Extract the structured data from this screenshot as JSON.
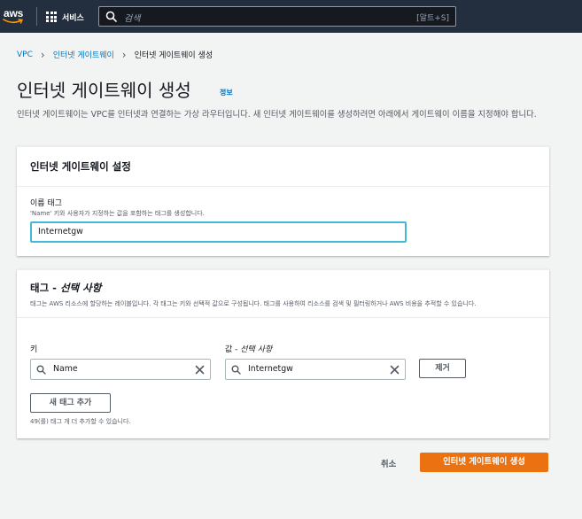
{
  "nav": {
    "logo_text": "aws",
    "services_label": "서비스",
    "search_placeholder": "검색",
    "search_shortcut": "[알트+S]"
  },
  "breadcrumb": {
    "items": [
      "VPC",
      "인터넷 게이트웨이",
      "인터넷 게이트웨이 생성"
    ]
  },
  "page": {
    "title": "인터넷 게이트웨이 생성",
    "info_label": "정보",
    "description": "인터넷 게이트웨이는 VPC를 인터넷과 연결하는 가상 라우터입니다. 새 인터넷 게이트웨이를 생성하려면 아래에서 게이트웨이 이름을 지정해야 합니다."
  },
  "settings_panel": {
    "header": "인터넷 게이트웨이 설정",
    "name_tag_label": "이름 태그",
    "name_tag_hint": "'Name' 키와 사용자가 지정하는 값을 포함하는 태그를 생성합니다.",
    "name_tag_value": "Internetgw"
  },
  "tags_panel": {
    "header": "태그 - ",
    "header_optional": "선택 사항",
    "description": "태그는 AWS 리소스에 할당하는 레이블입니다. 각 태그는 키와 선택적 값으로 구성됩니다. 태그를 사용하여 리소스를 검색 및 필터링하거나 AWS 비용을 추적할 수 있습니다.",
    "key_label": "키",
    "value_label": "값 - ",
    "value_label_optional": "선택 사항",
    "key_value": "Name",
    "value_value": "Internetgw",
    "remove_button": "제거",
    "add_button": "새 태그 추가",
    "remaining_text": "49(를) 태그 개 더 추가할 수 있습니다."
  },
  "footer": {
    "cancel_label": "취소",
    "create_label": "인터넷 게이트웨이 생성"
  },
  "colors": {
    "nav_bg": "#232f3e",
    "link": "#0073bb",
    "primary_button": "#ec7211",
    "focus_border": "#44b9d6"
  }
}
